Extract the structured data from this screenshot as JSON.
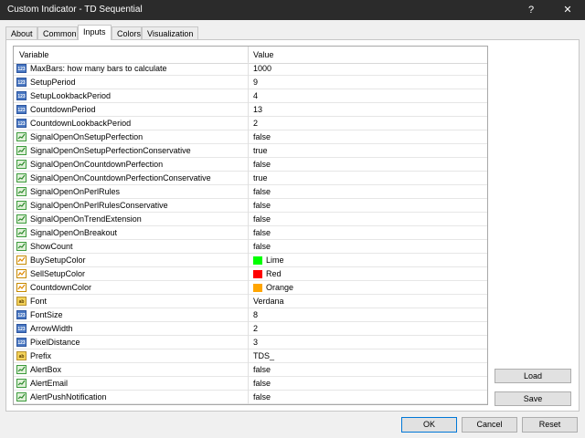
{
  "window": {
    "title": "Custom Indicator - TD Sequential",
    "help_label": "?",
    "close_label": "✕"
  },
  "tabs": [
    {
      "label": "About"
    },
    {
      "label": "Common"
    },
    {
      "label": "Inputs",
      "active": true
    },
    {
      "label": "Colors"
    },
    {
      "label": "Visualization"
    }
  ],
  "grid": {
    "headers": {
      "variable": "Variable",
      "value": "Value"
    },
    "rows": [
      {
        "icon": "int-icon",
        "name": "MaxBars: how many bars to calculate",
        "value": "1000"
      },
      {
        "icon": "int-icon",
        "name": "SetupPeriod",
        "value": "9"
      },
      {
        "icon": "int-icon",
        "name": "SetupLookbackPeriod",
        "value": "4"
      },
      {
        "icon": "int-icon",
        "name": "CountdownPeriod",
        "value": "13"
      },
      {
        "icon": "int-icon",
        "name": "CountdownLookbackPeriod",
        "value": "2"
      },
      {
        "icon": "bool-icon",
        "name": "SignalOpenOnSetupPerfection",
        "value": "false"
      },
      {
        "icon": "bool-icon",
        "name": "SignalOpenOnSetupPerfectionConservative",
        "value": "true"
      },
      {
        "icon": "bool-icon",
        "name": "SignalOpenOnCountdownPerfection",
        "value": "false"
      },
      {
        "icon": "bool-icon",
        "name": "SignalOpenOnCountdownPerfectionConservative",
        "value": "true"
      },
      {
        "icon": "bool-icon",
        "name": "SignalOpenOnPerlRules",
        "value": "false"
      },
      {
        "icon": "bool-icon",
        "name": "SignalOpenOnPerlRulesConservative",
        "value": "false"
      },
      {
        "icon": "bool-icon",
        "name": "SignalOpenOnTrendExtension",
        "value": "false"
      },
      {
        "icon": "bool-icon",
        "name": "SignalOpenOnBreakout",
        "value": "false"
      },
      {
        "icon": "bool-icon",
        "name": "ShowCount",
        "value": "false"
      },
      {
        "icon": "color-icon",
        "name": "BuySetupColor",
        "value": "Lime",
        "swatch": "#00ff00"
      },
      {
        "icon": "color-icon",
        "name": "SellSetupColor",
        "value": "Red",
        "swatch": "#ff0000"
      },
      {
        "icon": "color-icon",
        "name": "CountdownColor",
        "value": "Orange",
        "swatch": "#ffa500"
      },
      {
        "icon": "string-icon",
        "name": "Font",
        "value": "Verdana"
      },
      {
        "icon": "int-icon",
        "name": "FontSize",
        "value": "8"
      },
      {
        "icon": "int-icon",
        "name": "ArrowWidth",
        "value": "2"
      },
      {
        "icon": "int-icon",
        "name": "PixelDistance",
        "value": "3"
      },
      {
        "icon": "string-icon",
        "name": "Prefix",
        "value": "TDS_"
      },
      {
        "icon": "bool-icon",
        "name": "AlertBox",
        "value": "false"
      },
      {
        "icon": "bool-icon",
        "name": "AlertEmail",
        "value": "false"
      },
      {
        "icon": "bool-icon",
        "name": "AlertPushNotification",
        "value": "false"
      }
    ]
  },
  "buttons": {
    "load": "Load",
    "save": "Save",
    "ok": "OK",
    "cancel": "Cancel",
    "reset": "Reset"
  }
}
